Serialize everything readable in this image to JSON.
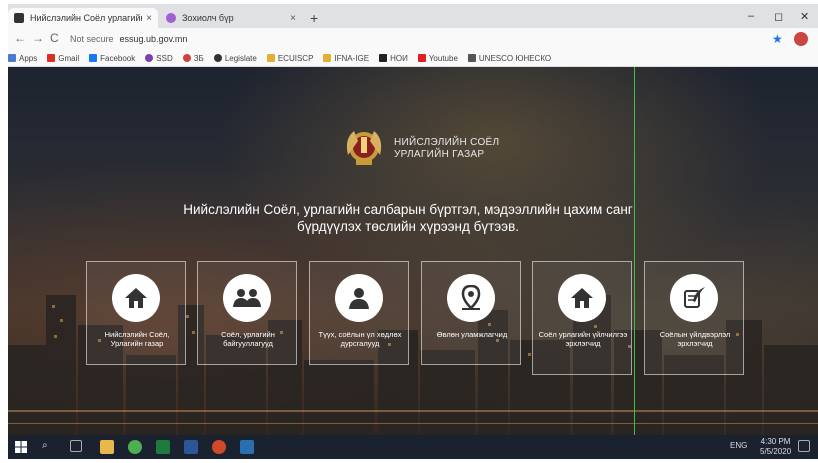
{
  "browser": {
    "tabs": [
      {
        "title": "Нийслэлийн Соёл урлагийн газ",
        "active": true,
        "favicon_color": "#333333"
      },
      {
        "title": "Зохиолч бүр",
        "active": false,
        "favicon_color": "#a060d0"
      }
    ],
    "new_tab": "+",
    "close": "×",
    "window": {
      "minimize": "–",
      "maximize": "◻",
      "close": "✕"
    },
    "nav": {
      "back": "←",
      "forward": "→",
      "reload": "C"
    },
    "address": {
      "security": "Not secure",
      "url": "essug.ub.gov.mn"
    },
    "bookmarks": [
      {
        "label": "Apps",
        "color": "#4a7bd0"
      },
      {
        "label": "Gmail",
        "color": "#d93025"
      },
      {
        "label": "Facebook",
        "color": "#1877f2"
      },
      {
        "label": "SSD",
        "color": "#7a3fb0"
      },
      {
        "label": "ЗБ",
        "color": "#d04040"
      },
      {
        "label": "Legislate",
        "color": "#333333"
      },
      {
        "label": "ECUISCP",
        "color": "#e0b030"
      },
      {
        "label": "IFNA-IGE",
        "color": "#e0b030"
      },
      {
        "label": "НОИ",
        "color": "#222222"
      },
      {
        "label": "Youtube",
        "color": "#e02020"
      },
      {
        "label": "UNESCO ЮНЕСКО",
        "color": "#555555"
      }
    ]
  },
  "site": {
    "org_name_line1": "НИЙСЛЭЛИЙН СОЁЛ",
    "org_name_line2": "УРЛАГИЙН ГАЗАР",
    "headline_line1": "Нийслэлийн Соёл, урлагийн салбарын бүртгэл, мэдээллийн цахим санг",
    "headline_line2": "бүрдүүлэх төслийн хүрээнд бүтээв.",
    "cards": [
      {
        "label": "Нийслэлийн Соёл, Урлагийн газар",
        "icon": "home-icon"
      },
      {
        "label": "Соёл, урлагийн байгууллагууд",
        "icon": "group-icon"
      },
      {
        "label": "Түүх, соёлын үл хөдлөх дурсгалууд",
        "icon": "person-icon"
      },
      {
        "label": "Өвлөн уламжлагчид",
        "icon": "location-pin-icon"
      },
      {
        "label": "Соёл урлагийн үйлчилгээ эрхлэгчид",
        "icon": "home-icon"
      },
      {
        "label": "Соёлын үйлдвэрлэл эрхлэгчид",
        "icon": "scroll-quill-icon"
      }
    ]
  },
  "taskbar": {
    "language": "ENG",
    "time": "4:30 PM",
    "date": "5/5/2020"
  }
}
